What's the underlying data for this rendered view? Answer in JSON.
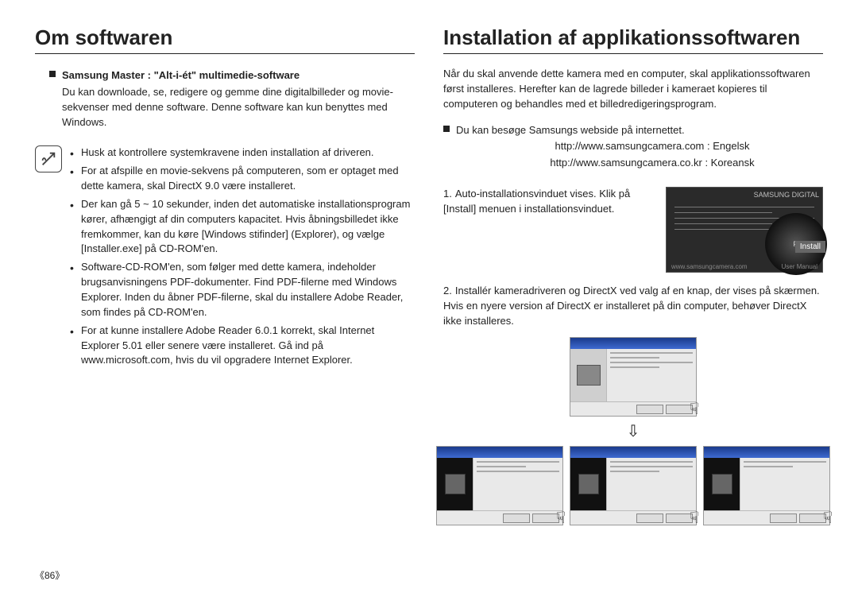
{
  "left": {
    "heading": "Om softwaren",
    "master_title": "Samsung Master : \"Alt-i-ét\" multimedie-software",
    "master_body": "Du kan downloade, se, redigere og gemme dine digitalbilleder og movie-sekvenser med denne software. Denne software kan kun benyttes med Windows.",
    "notes": [
      "Husk at kontrollere systemkravene inden installation af driveren.",
      "For at afspille en movie-sekvens på computeren, som er optaget med dette kamera, skal DirectX 9.0 være installeret.",
      "Der kan gå 5 ~ 10 sekunder, inden det automatiske installationsprogram kører, afhængigt af din computers kapacitet. Hvis åbningsbilledet ikke fremkommer, kan du køre [Windows stifinder] (Explorer), og vælge [Installer.exe] på CD-ROM'en.",
      "Software-CD-ROM'en, som følger med dette kamera, indeholder brugsanvisningens PDF-dokumenter. Find PDF-filerne med Windows Explorer. Inden du åbner PDF-filerne, skal du installere Adobe Reader, som findes på CD-ROM'en.",
      "For at kunne installere Adobe Reader 6.0.1 korrekt, skal Internet Explorer 5.01 eller senere være installeret. Gå ind på www.microsoft.com, hvis du vil opgradere Internet Explorer."
    ]
  },
  "right": {
    "heading": "Installation af applikationssoftwaren",
    "intro": "Når du skal anvende dette kamera med en computer, skal applikationssoftwaren først installeres. Herefter kan de lagrede billeder i kameraet kopieres til computeren og behandles med et billedredigeringsprogram.",
    "weblink_intro": "Du kan besøge Samsungs webside på internettet.",
    "url_en": "http://www.samsungcamera.com : Engelsk",
    "url_kr": "http://www.samsungcamera.co.kr : Koreansk",
    "step1_num": "1.",
    "step1_text": "Auto-installationsvinduet vises. Klik på [Install] menuen i installationsvinduet.",
    "thumb": {
      "brand": "SAMSUNG DIGITAL",
      "pdf_badge": "PDF file.",
      "install_btn": "Install",
      "site_left": "www.samsungcamera.com",
      "site_right": "User Manual"
    },
    "step2_num": "2.",
    "step2_text": "Installér kameradriveren og DirectX ved valg af en knap, der vises på skærmen. Hvis en nyere version af DirectX er installeret på din computer, behøver DirectX ikke installeres."
  },
  "page_num": "《86》",
  "arrow": "⇩"
}
